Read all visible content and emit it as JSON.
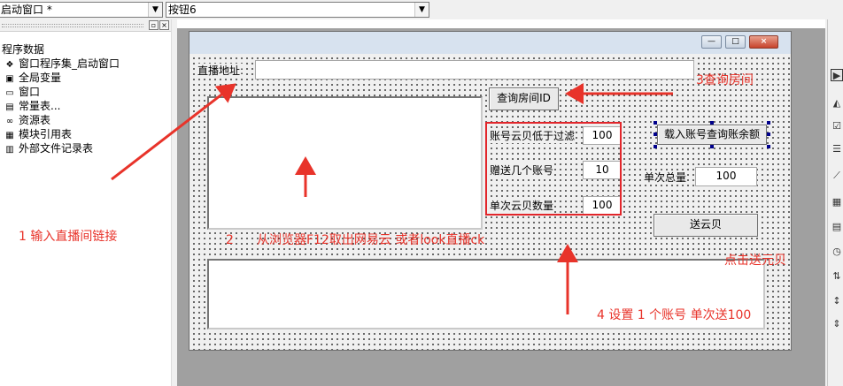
{
  "toolbar": {
    "window_combo": "启动窗口 *",
    "control_combo": "按钮6"
  },
  "left_panel": {
    "root_label": "程序数据",
    "items": [
      {
        "label": "窗口程序集_启动窗口",
        "icon": "assembly-icon"
      },
      {
        "label": "全局变量",
        "icon": "global-var-icon"
      },
      {
        "label": "窗口",
        "icon": "window-icon"
      },
      {
        "label": "常量表...",
        "icon": "constants-icon"
      },
      {
        "label": "资源表",
        "icon": "resource-icon"
      },
      {
        "label": "模块引用表",
        "icon": "module-icon"
      },
      {
        "label": "外部文件记录表",
        "icon": "file-record-icon"
      }
    ]
  },
  "form": {
    "live_url_label": "直播地址:",
    "live_url_value": "",
    "query_room_button": "查询房间ID",
    "load_account_button": "载入账号查询账余额",
    "send_button": "送云贝",
    "filter_label": "账号云贝低于过滤",
    "filter_value": "100",
    "gift_accounts_label": "赠送几个账号",
    "gift_accounts_value": "10",
    "per_count_label": "单次云贝数量",
    "per_count_value": "100",
    "total_label": "单次总量",
    "total_value": "100"
  },
  "annotations": {
    "step1": "1  输入直播间链接",
    "step2_num": "2",
    "step2_text": "从浏览器F12取出网易云  或者look直播ck",
    "step3": "3查询房间",
    "step4": "4 设置 1 个账号  单次送100",
    "step5": "点击送元贝"
  },
  "colors": {
    "annotation_red": "#e8332a",
    "title_bar": "#d7e2ef"
  }
}
